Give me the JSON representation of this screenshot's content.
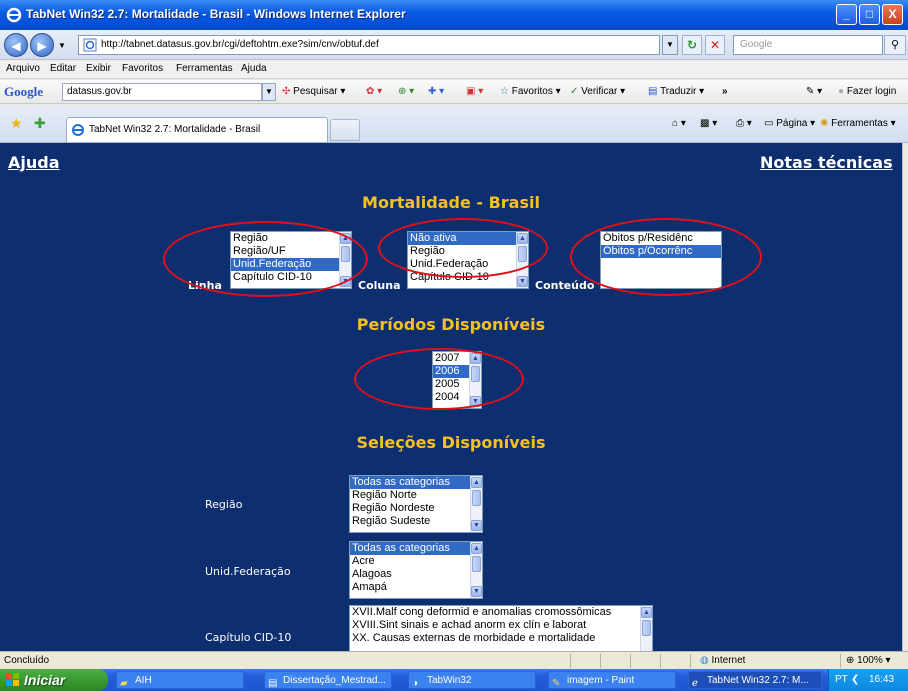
{
  "window": {
    "title": "TabNet Win32 2.7: Mortalidade - Brasil - Windows Internet Explorer",
    "minimize": "_",
    "maximize": "□",
    "close": "X"
  },
  "address": {
    "back": "◀",
    "forward": "▶",
    "url": "http://tabnet.datasus.gov.br/cgi/deftohtm.exe?sim/cnv/obtuf.def",
    "search_placeholder": "Google"
  },
  "menu": [
    "Arquivo",
    "Editar",
    "Exibir",
    "Favoritos",
    "Ferramentas",
    "Ajuda"
  ],
  "google_toolbar": {
    "logo": "Google",
    "query": "datasus.gov.br",
    "pesquisar": "Pesquisar",
    "favoritos": "Favoritos",
    "verificar": "Verificar",
    "traduzir": "Traduzir",
    "more": "»",
    "login": "Fazer login"
  },
  "tabs": {
    "active_tab": "TabNet Win32 2.7: Mortalidade - Brasil",
    "pagina": "Página",
    "ferramentas": "Ferramentas"
  },
  "page": {
    "help_link": "Ajuda",
    "notes_link": "Notas técnicas",
    "main_title": "Mortalidade - Brasil",
    "linha_label": "Linha",
    "coluna_label": "Coluna",
    "conteudo_label": "Conteúdo",
    "linha_options": [
      "Região",
      "Região/UF",
      "Unid.Federação",
      "Capítulo CID-10"
    ],
    "coluna_options": [
      "Não ativa",
      "Região",
      "Unid.Federação",
      "Capítulo CID-10"
    ],
    "conteudo_options": [
      "Óbitos p/Residênc",
      "Óbitos p/Ocorrênc"
    ],
    "periods_title": "Períodos Disponíveis",
    "period_options": [
      "2007",
      "2006",
      "2005",
      "2004"
    ],
    "selections_title": "Seleções Disponíveis",
    "regiao_label": "Região",
    "regiao_options": [
      "Todas as categorias",
      "Região Norte",
      "Região Nordeste",
      "Região Sudeste"
    ],
    "uf_label": "Unid.Federação",
    "uf_options": [
      "Todas as categorias",
      "Acre",
      "Alagoas",
      "Amapá"
    ],
    "cid_label": "Capítulo CID-10",
    "cid_options": [
      "XVII.Malf cong deformid e anomalias cromossômicas",
      "XVIII.Sint sinais e achad anorm ex clín e laborat",
      "XX. Causas externas de morbidade e mortalidade"
    ]
  },
  "status": {
    "text": "Concluído",
    "zone": "Internet",
    "zoom": "100%"
  },
  "taskbar": {
    "start": "Iniciar",
    "items": [
      "AIH",
      "Dissertação_Mestrad...",
      "TabWin32",
      "imagem - Paint",
      "TabNet Win32 2.7: M..."
    ],
    "lang": "PT",
    "clock": "16:43"
  },
  "colors": {
    "page_background": "#0d2f6f",
    "section_title": "#f5c022",
    "selection_highlight": "#316ac5",
    "annotation_ellipse": "#e0101a"
  }
}
